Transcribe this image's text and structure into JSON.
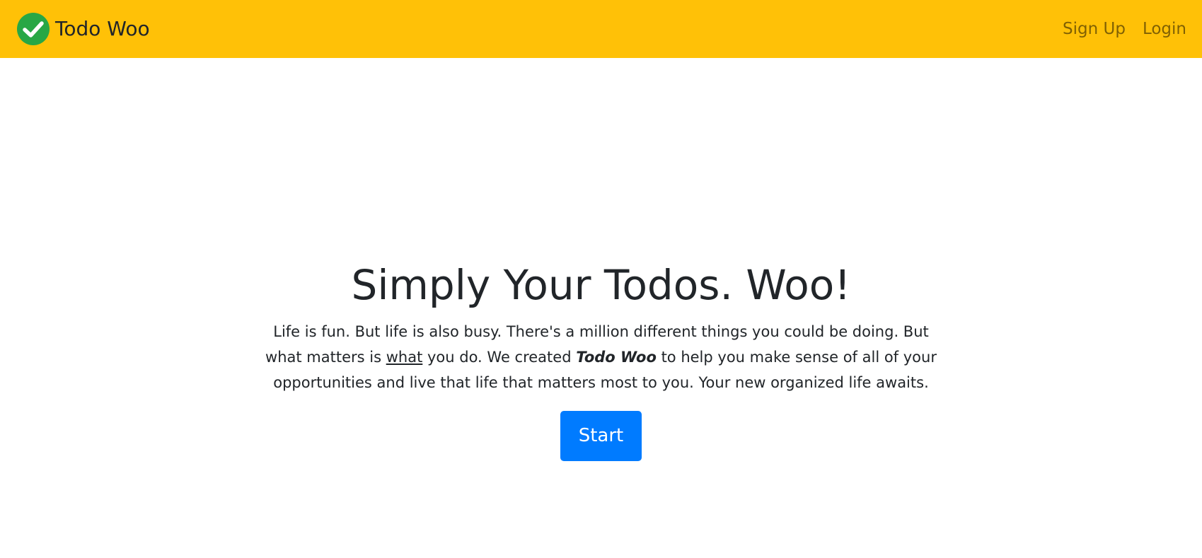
{
  "navbar": {
    "brand_icon": "check-circle-icon",
    "brand_text": "Todo Woo",
    "links": {
      "signup": "Sign Up",
      "login": "Login"
    },
    "background_color": "#ffc107"
  },
  "hero": {
    "title": "Simply Your Todos. Woo!",
    "paragraph": {
      "part1": "Life is fun. But life is also busy. There's a million different things you could be doing. But what matters is ",
      "underlined": "what",
      "part2": " you do. We created ",
      "emphasis": "Todo Woo",
      "part3": " to help you make sense of all of your opportunities and live that life that matters most to you. Your new organized life awaits."
    },
    "start_button": "Start",
    "button_color": "#007bff"
  }
}
